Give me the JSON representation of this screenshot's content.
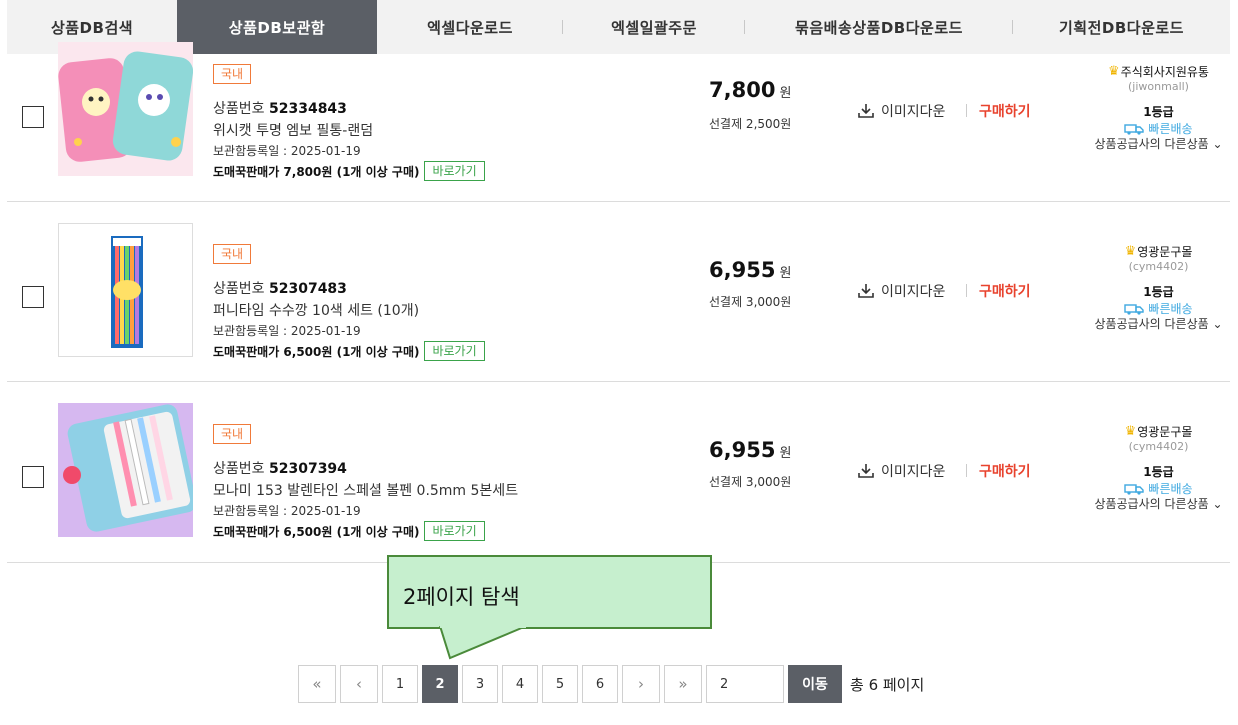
{
  "tabs": [
    {
      "label": "상품DB검색",
      "active": false
    },
    {
      "label": "상품DB보관함",
      "active": true
    },
    {
      "label": "엑셀다운로드",
      "active": false
    },
    {
      "label": "엑셀일괄주문",
      "active": false
    },
    {
      "label": "묶음배송상품DB다운로드",
      "active": false
    },
    {
      "label": "기획전DB다운로드",
      "active": false
    }
  ],
  "products": [
    {
      "origin_badge": "국내",
      "id_label": "상품번호",
      "id": "52334843",
      "name": "위시캣 투명 엠보 필통-랜덤",
      "saved_date": "보관함등록일 : 2025-01-19",
      "wholesale": "도매꾹판매가 7,800원 (1개 이상 구매)",
      "goto_label": "바로가기",
      "price": "7,800",
      "price_unit": "원",
      "shipping": "선결제 2,500원",
      "image_download": "이미지다운",
      "buy": "구매하기",
      "seller_name": "주식회사지원유통",
      "seller_id": "(jiwonmall)",
      "grade": "1등급",
      "fast_ship": "빠른배송",
      "other_products": "상품공급사의 다른상품"
    },
    {
      "origin_badge": "국내",
      "id_label": "상품번호",
      "id": "52307483",
      "name": "퍼니타임 수수깡 10색 세트 (10개)",
      "saved_date": "보관함등록일 : 2025-01-19",
      "wholesale": "도매꾹판매가 6,500원 (1개 이상 구매)",
      "goto_label": "바로가기",
      "price": "6,955",
      "price_unit": "원",
      "shipping": "선결제 3,000원",
      "image_download": "이미지다운",
      "buy": "구매하기",
      "seller_name": "영광문구몰",
      "seller_id": "(cym4402)",
      "grade": "1등급",
      "fast_ship": "빠른배송",
      "other_products": "상품공급사의 다른상품"
    },
    {
      "origin_badge": "국내",
      "id_label": "상품번호",
      "id": "52307394",
      "name": "모나미 153 발렌타인 스페셜 볼펜 0.5mm 5본세트",
      "saved_date": "보관함등록일 : 2025-01-19",
      "wholesale": "도매꾹판매가 6,500원 (1개 이상 구매)",
      "goto_label": "바로가기",
      "price": "6,955",
      "price_unit": "원",
      "shipping": "선결제 3,000원",
      "image_download": "이미지다운",
      "buy": "구매하기",
      "seller_name": "영광문구몰",
      "seller_id": "(cym4402)",
      "grade": "1등급",
      "fast_ship": "빠른배송",
      "other_products": "상품공급사의 다른상품"
    }
  ],
  "callout": {
    "text": "2페이지 탐색"
  },
  "pagination": {
    "first": "«",
    "prev": "‹",
    "pages": [
      "1",
      "2",
      "3",
      "4",
      "5",
      "6"
    ],
    "current": "2",
    "next": "›",
    "last": "»",
    "input_value": "2",
    "go_label": "이동",
    "total": "총 6 페이지"
  },
  "colors": {
    "active_tab": "#5b5f66",
    "buy": "#e8432e",
    "badge": "#f07a3a",
    "goto": "#3aa34a",
    "fast_ship": "#3fa9e0",
    "callout_bg": "#c6efce",
    "callout_border": "#4a8a3a"
  }
}
